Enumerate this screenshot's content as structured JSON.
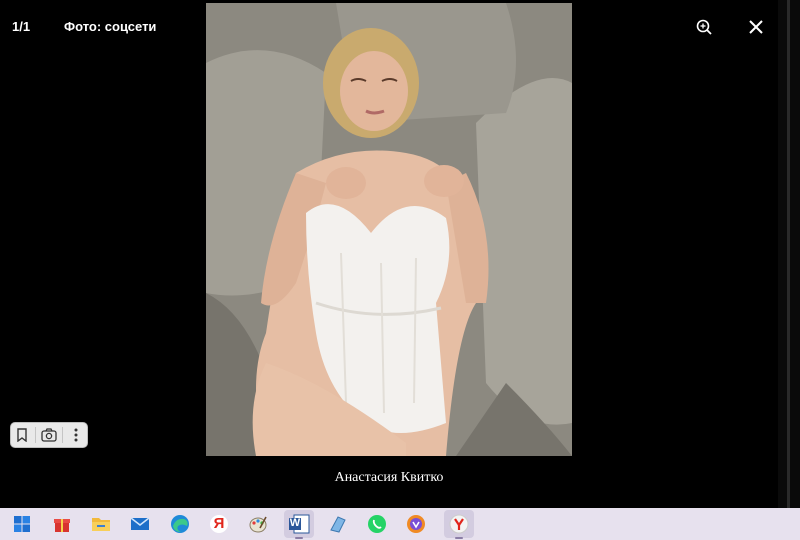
{
  "viewer": {
    "counter": "1/1",
    "source": "Фото: соцсети",
    "caption": "Анастасия Квитко",
    "zoom_icon": "zoom-in-icon",
    "close_icon": "close-icon"
  },
  "mini_toolbar": {
    "icons": [
      "bookmark-icon",
      "camera-icon",
      "more-vertical-icon"
    ]
  },
  "taskbar": {
    "apps": [
      {
        "name": "start",
        "icon": "windows-logo-icon"
      },
      {
        "name": "gift",
        "icon": "gift-icon"
      },
      {
        "name": "file-explorer",
        "icon": "folder-icon"
      },
      {
        "name": "mail",
        "icon": "mail-icon"
      },
      {
        "name": "edge",
        "icon": "edge-icon"
      },
      {
        "name": "yandex",
        "icon": "yandex-icon",
        "label": "Я"
      },
      {
        "name": "paint",
        "icon": "paint-icon"
      },
      {
        "name": "word",
        "icon": "word-icon",
        "label": "W"
      },
      {
        "name": "notes",
        "icon": "notes-icon"
      },
      {
        "name": "whatsapp",
        "icon": "whatsapp-icon"
      },
      {
        "name": "browser",
        "icon": "browser-icon"
      },
      {
        "name": "yandex-browser",
        "icon": "yandex-browser-icon"
      }
    ]
  },
  "colors": {
    "background": "#000000",
    "taskbar": "#e7e1ee",
    "sofa": "#8e8a80",
    "lingerie": "#f3f1ee"
  }
}
